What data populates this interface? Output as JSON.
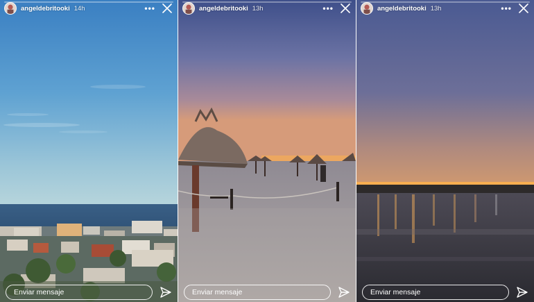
{
  "stories": [
    {
      "username": "angeldebritooki",
      "time": "14h",
      "more_icon": "more-horizontal-icon",
      "close_icon": "close-icon",
      "message_placeholder": "Enviar mensaje",
      "send_icon": "send-icon",
      "progress": 0.0
    },
    {
      "username": "angeldebritooki",
      "time": "13h",
      "more_icon": "more-horizontal-icon",
      "close_icon": "close-icon",
      "message_placeholder": "Enviar mensaje",
      "send_icon": "send-icon",
      "progress": 0.0
    },
    {
      "username": "angeldebritooki",
      "time": "13h",
      "more_icon": "more-horizontal-icon",
      "close_icon": "close-icon",
      "message_placeholder": "Enviar mensaje",
      "send_icon": "send-icon",
      "progress": 0.0
    }
  ],
  "colors": {
    "ui_text": "#ffffff",
    "sky_day_top": "#3e86c6",
    "sky_day_bottom": "#a9cbd6",
    "sky_dusk_top": "#4a5b92",
    "sky_dusk_bottom": "#c49283",
    "city_lights": "#ffb14a"
  }
}
